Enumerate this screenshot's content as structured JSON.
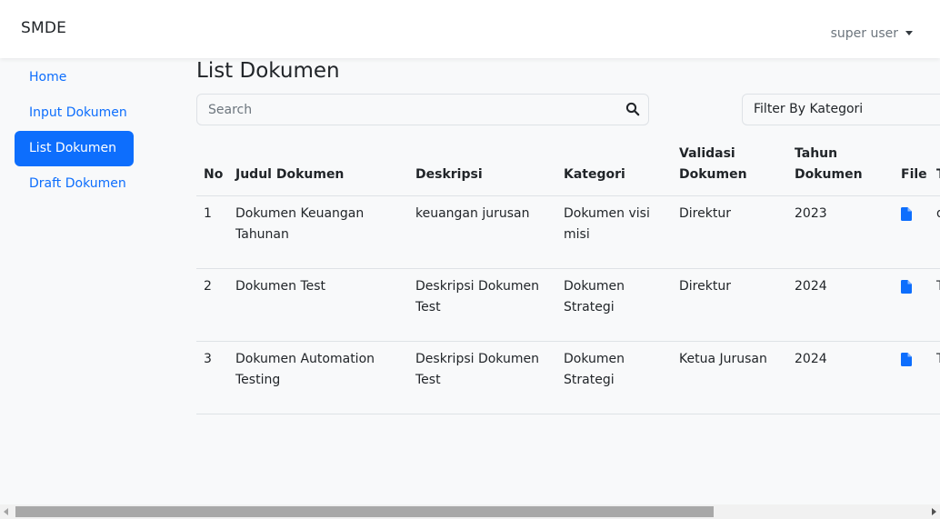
{
  "app": {
    "brand": "SMDE"
  },
  "header": {
    "user_label": "super user",
    "dropdown_icon": "caret-down-icon"
  },
  "sidebar": {
    "items": [
      {
        "label": "Home",
        "active": false
      },
      {
        "label": "Input Dokumen",
        "active": false
      },
      {
        "label": "List Dokumen",
        "active": true
      },
      {
        "label": "Draft Dokumen",
        "active": false
      }
    ]
  },
  "main": {
    "title": "List Dokumen",
    "search": {
      "placeholder": "Search",
      "value": "",
      "icon": "search-icon"
    },
    "filter": {
      "label": "Filter By Kategori"
    }
  },
  "table": {
    "headers": [
      "No",
      "Judul Dokumen",
      "Deskripsi",
      "Kategori",
      "Validasi Dokumen",
      "Tahun Dokumen",
      "File",
      "T"
    ],
    "rows": [
      {
        "no": "1",
        "judul": "Dokumen Keuangan Tahunan",
        "deskripsi": "keuangan jurusan",
        "kategori": "Dokumen visi misi",
        "validasi": "Direktur",
        "tahun": "2023",
        "file_icon": "file-icon",
        "extra": "d b"
      },
      {
        "no": "2",
        "judul": "Dokumen Test",
        "deskripsi": "Deskripsi Dokumen Test",
        "kategori": "Dokumen Strategi",
        "validasi": "Direktur",
        "tahun": "2024",
        "file_icon": "file-icon",
        "extra": "T"
      },
      {
        "no": "3",
        "judul": "Dokumen Automation Testing",
        "deskripsi": "Deskripsi Dokumen Test",
        "kategori": "Dokumen Strategi",
        "validasi": "Ketua Jurusan",
        "tahun": "2024",
        "file_icon": "file-icon",
        "extra": "T"
      }
    ]
  },
  "colors": {
    "primary": "#0d6efd",
    "background": "#f8f9fa",
    "navbar": "#ffffff",
    "text": "#212529",
    "muted": "#6c757d",
    "border": "#dee2e6"
  }
}
